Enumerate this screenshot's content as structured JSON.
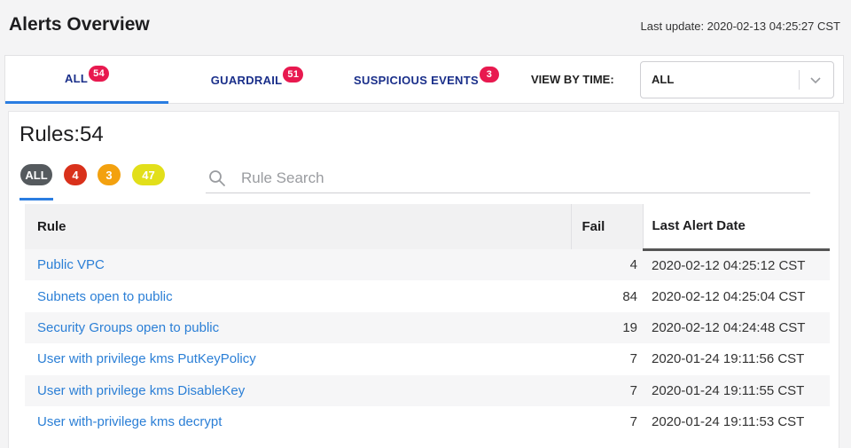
{
  "header": {
    "title": "Alerts Overview",
    "last_update": "Last update: 2020-02-13 04:25:27 CST"
  },
  "tabs": [
    {
      "label": "ALL",
      "count": "54"
    },
    {
      "label": "GUARDRAIL",
      "count": "51"
    },
    {
      "label": "SUSPICIOUS EVENTS",
      "count": "3"
    }
  ],
  "view_by_time": {
    "label": "VIEW BY TIME:",
    "selected": "ALL"
  },
  "rules": {
    "title": "Rules:54",
    "filters": [
      {
        "label": "ALL",
        "color": "#555a5e"
      },
      {
        "label": "4",
        "color": "#d9311b"
      },
      {
        "label": "3",
        "color": "#f3a10f"
      },
      {
        "label": "47",
        "color": "#e2df1a"
      }
    ],
    "search_placeholder": "Rule Search"
  },
  "table": {
    "headers": [
      "Rule",
      "Fail",
      "Last Alert Date"
    ],
    "rows": [
      {
        "rule": "Public VPC",
        "fail": "4",
        "date": "2020-02-12 04:25:12 CST"
      },
      {
        "rule": "Subnets open to public",
        "fail": "84",
        "date": "2020-02-12 04:25:04 CST"
      },
      {
        "rule": "Security Groups open to public",
        "fail": "19",
        "date": "2020-02-12 04:24:48 CST"
      },
      {
        "rule": "User with privilege kms PutKeyPolicy",
        "fail": "7",
        "date": "2020-01-24 19:11:56 CST"
      },
      {
        "rule": "User with privilege kms DisableKey",
        "fail": "7",
        "date": "2020-01-24 19:11:55 CST"
      },
      {
        "rule": "User with-privilege kms decrypt",
        "fail": "7",
        "date": "2020-01-24 19:11:53 CST"
      }
    ]
  },
  "colors": {
    "accent": "#2a7de1",
    "tab_text": "#1a2f8a",
    "count_badge": "#e8194f",
    "link": "#2b7fd6"
  },
  "icons": {
    "search": "search-icon",
    "dropdown": "chevron-down-icon"
  }
}
